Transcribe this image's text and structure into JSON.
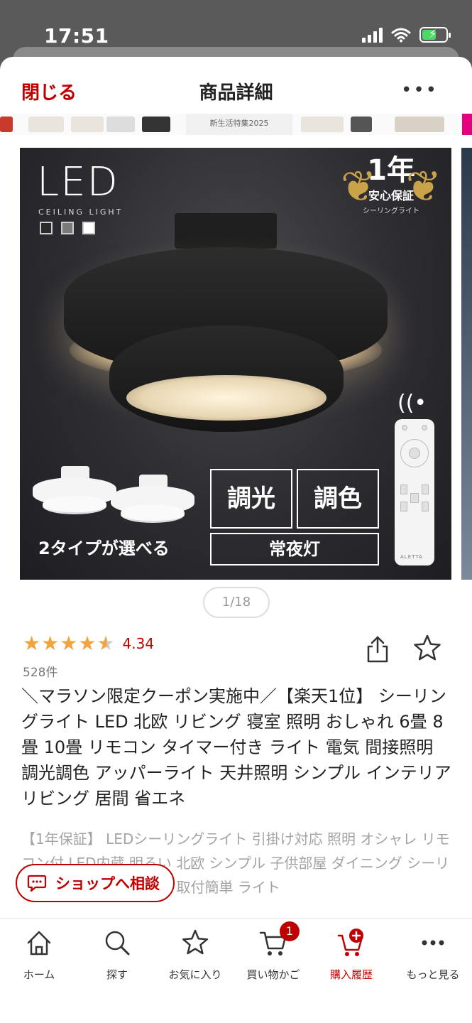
{
  "status_bar": {
    "time": "17:51"
  },
  "header": {
    "close_label": "閉じる",
    "title": "商品詳細",
    "more_label": "•••"
  },
  "banner": {
    "label": "新生活特集2025"
  },
  "product_image": {
    "led_text": "LED",
    "ceiling_text": "CEILING LIGHT",
    "warranty_year": "1年",
    "warranty_label": "安心保証",
    "warranty_caption": "シーリングライト",
    "feature_1": "調光",
    "feature_2": "調色",
    "feature_3": "常夜灯",
    "types_label": "2タイプが選べる",
    "remote_brand": "ALETTA",
    "swatch_colors": [
      "#2b2b2b",
      "#7a7a7a",
      "#ffffff"
    ]
  },
  "gallery": {
    "page_indicator": "1/18",
    "current": 1,
    "total": 18
  },
  "rating": {
    "value_text": "4.34",
    "value": 4.34,
    "max": 5,
    "count_text": "528件"
  },
  "product": {
    "title": "＼マラソン限定クーポン実施中／【楽天1位】 シーリングライト LED 北欧 リビング 寝室 照明 おしゃれ 6畳 8畳 10畳 リモコン タイマー付き ライト 電気 間接照明 調光調色 アッパーライト 天井照明 シンプル インテリア リビング  居間 省エネ",
    "description": "【1年保証】 LEDシーリングライト 引掛け対応 照明 オシャレ リモコン付 LED内蔵 明るい 北欧 シンプル 子供部屋 ダイニング シーリングランプ 食卓 新生活 取付簡単 ライト"
  },
  "consult_button": {
    "label": "ショップへ相談"
  },
  "bottom_nav": {
    "items": [
      {
        "label": "ホーム",
        "icon": "home-icon"
      },
      {
        "label": "探す",
        "icon": "search-icon"
      },
      {
        "label": "お気に入り",
        "icon": "star-icon"
      },
      {
        "label": "買い物かご",
        "icon": "cart-icon"
      },
      {
        "label": "購入履歴",
        "icon": "purchase-history-icon"
      },
      {
        "label": "もっと見る",
        "icon": "more-icon"
      }
    ],
    "cart_badge": "1"
  },
  "colors": {
    "accent": "#bf0000",
    "star": "#f2a33a"
  }
}
